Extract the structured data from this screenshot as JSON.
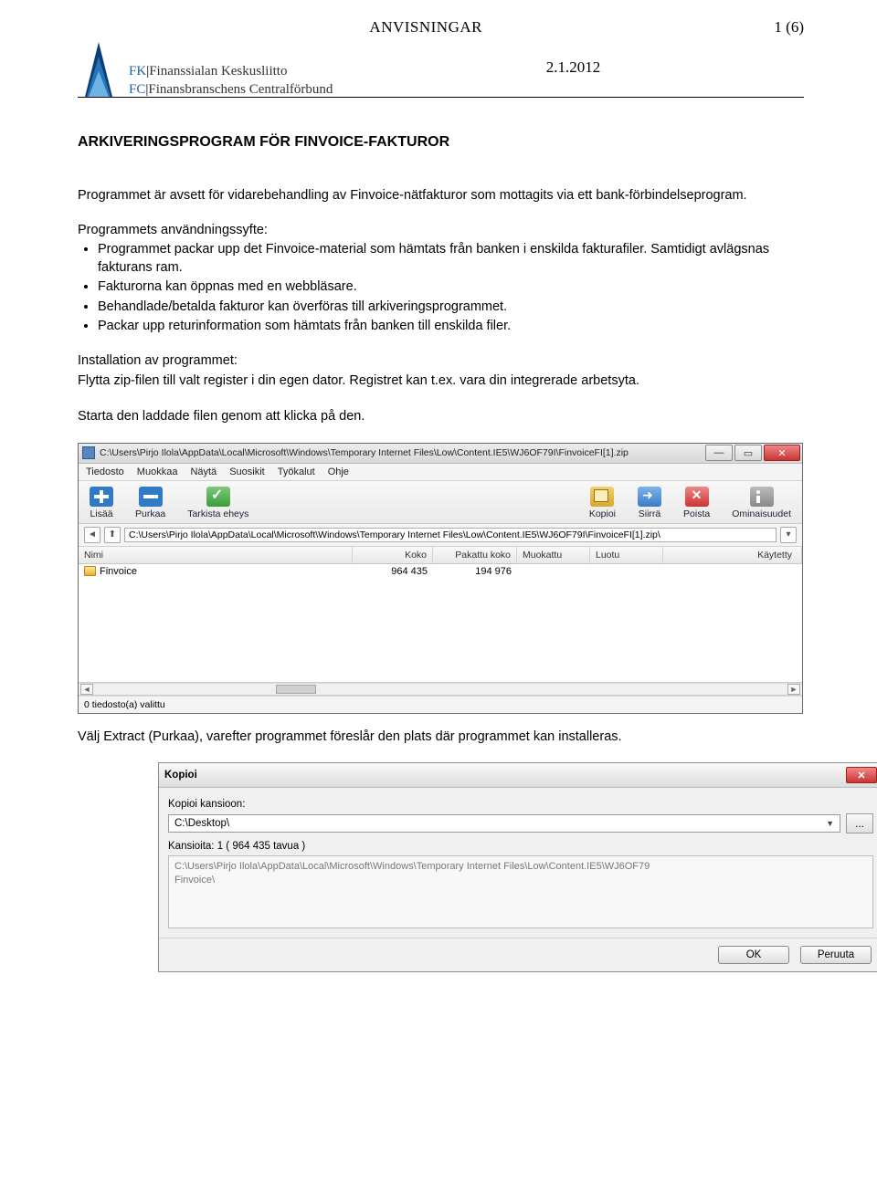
{
  "header": {
    "doc_type": "ANVISNINGAR",
    "page_indicator": "1 (6)",
    "date": "2.1.2012",
    "org_fk_abbr": "FK",
    "org_fk_full": "Finanssialan Keskusliitto",
    "org_fc_abbr": "FC",
    "org_fc_full": "Finansbranschens Centralförbund"
  },
  "doc": {
    "h1": "ARKIVERINGSPROGRAM FÖR FINVOICE-FAKTUROR",
    "intro": "Programmet är avsett för vidarebehandling av Finvoice-nätfakturor som mottagits via ett bank-förbindelseprogram.",
    "purpose_label": "Programmets användningssyfte:",
    "purpose_items": [
      "Programmet packar upp det Finvoice-material som hämtats från banken i enskilda fakturafiler. Samtidigt avlägsnas fakturans ram.",
      "Fakturorna kan öppnas med en webbläsare.",
      "Behandlade/betalda fakturor kan överföras till arkiveringsprogrammet.",
      "Packar upp returinformation som hämtats från banken till enskilda filer."
    ],
    "install_label": "Installation av programmet:",
    "install_p1": "Flytta zip-filen till valt register i din egen dator. Registret kan t.ex. vara din integrerade arbetsyta.",
    "install_p2": "Starta den laddade filen genom att klicka på den.",
    "after_shot": "Välj Extract (Purkaa), varefter programmet föreslår den plats där programmet kan installeras."
  },
  "izarc": {
    "title_path": "C:\\Users\\Pirjo Ilola\\AppData\\Local\\Microsoft\\Windows\\Temporary Internet Files\\Low\\Content.IE5\\WJ6OF79I\\FinvoiceFI[1].zip",
    "menu": [
      "Tiedosto",
      "Muokkaa",
      "Näytä",
      "Suosikit",
      "Työkalut",
      "Ohje"
    ],
    "toolbar": {
      "lisaa": "Lisää",
      "purkaa": "Purkaa",
      "tarkista": "Tarkista eheys",
      "kopioi": "Kopioi",
      "siirra": "Siirrä",
      "poista": "Poista",
      "omin": "Ominaisuudet"
    },
    "addr_path": "C:\\Users\\Pirjo Ilola\\AppData\\Local\\Microsoft\\Windows\\Temporary Internet Files\\Low\\Content.IE5\\WJ6OF79I\\FinvoiceFI[1].zip\\",
    "cols": {
      "name": "Nimi",
      "size": "Koko",
      "psize": "Pakattu koko",
      "mod": "Muokattu",
      "created": "Luotu",
      "used": "Käytetty"
    },
    "row": {
      "name": "Finvoice",
      "size": "964 435",
      "psize": "194 976"
    },
    "status": "0 tiedosto(a) valittu"
  },
  "kopioi": {
    "title": "Kopioi",
    "label_to": "Kopioi kansioon:",
    "selected": "C:\\Desktop\\",
    "browse": "...",
    "count_line": "Kansioita: 1    ( 964 435 tavua )",
    "path_text": "C:\\Users\\Pirjo Ilola\\AppData\\Local\\Microsoft\\Windows\\Temporary Internet Files\\Low\\Content.IE5\\WJ6OF79\nFinvoice\\",
    "ok": "OK",
    "cancel": "Peruuta"
  }
}
